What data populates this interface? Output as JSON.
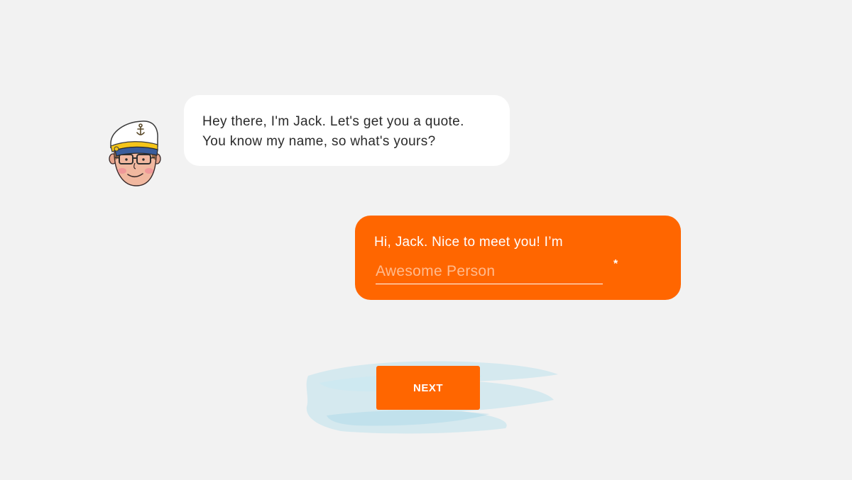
{
  "colors": {
    "background": "#f2f2f2",
    "accent": "#ff6600",
    "bot_bubble": "#ffffff",
    "brush": "#a9dceb"
  },
  "bot": {
    "avatar_icon": "captain-jack-avatar-icon",
    "message_lines": [
      "Hey there, I'm Jack. Let's get you a quote.",
      "You know my name, so what's yours?"
    ]
  },
  "user": {
    "intro": "Hi, Jack. Nice to meet you! I’m",
    "name_input": {
      "value": "",
      "placeholder": "Awesome Person"
    },
    "required_mark": "*"
  },
  "actions": {
    "next_label": "NEXT"
  }
}
